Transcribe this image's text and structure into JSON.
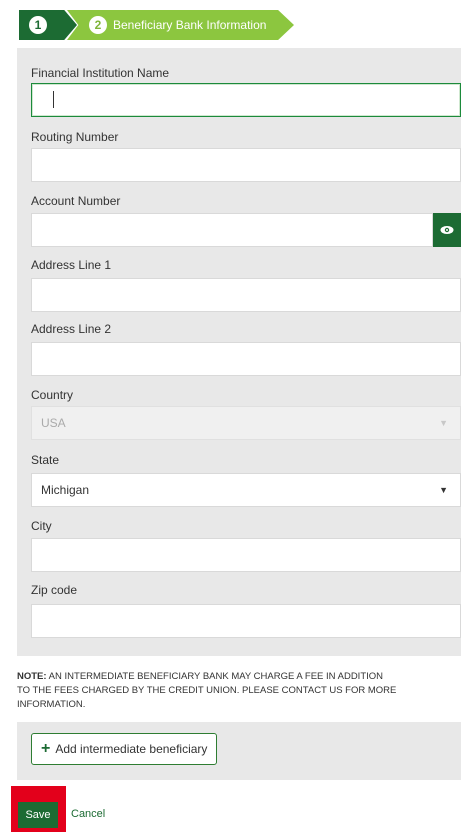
{
  "stepper": {
    "step1_number": "1",
    "step2_number": "2",
    "step2_label": "Beneficiary Bank Information"
  },
  "form": {
    "financial_institution_name": {
      "label": "Financial Institution Name",
      "value": ""
    },
    "routing_number": {
      "label": "Routing Number",
      "value": ""
    },
    "account_number": {
      "label": "Account Number",
      "value": ""
    },
    "address_line_1": {
      "label": "Address Line 1",
      "value": ""
    },
    "address_line_2": {
      "label": "Address Line 2",
      "value": ""
    },
    "country": {
      "label": "Country",
      "value": "USA",
      "arrow": "▼"
    },
    "state": {
      "label": "State",
      "value": "Michigan",
      "arrow": "▼"
    },
    "city": {
      "label": "City",
      "value": ""
    },
    "zip_code": {
      "label": "Zip code",
      "value": ""
    }
  },
  "note": {
    "prefix": "NOTE:",
    "line1": " AN INTERMEDIATE BENEFICIARY BANK MAY CHARGE A FEE IN ADDITION",
    "line2": "TO THE FEES CHARGED BY THE CREDIT UNION. PLEASE CONTACT US FOR MORE",
    "line3": "INFORMATION."
  },
  "actions": {
    "add_plus": "+",
    "add_intermediate_label": "Add intermediate beneficiary",
    "save_label": "Save",
    "cancel_label": "Cancel"
  },
  "colors": {
    "primary_green": "#1c6b33",
    "light_green": "#8cc63f",
    "highlight_red": "#e3001b"
  },
  "icons": {
    "visibility": "eye-icon",
    "add": "plus-icon",
    "dropdown": "chevron-down-icon"
  }
}
